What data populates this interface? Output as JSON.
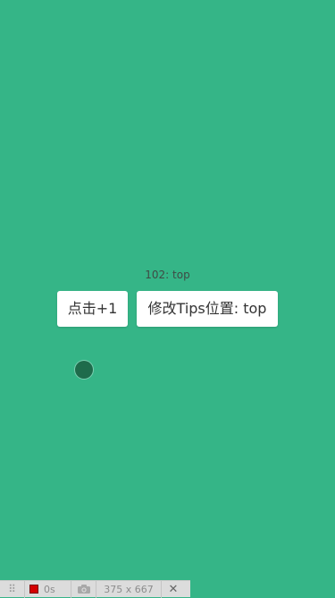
{
  "tip": {
    "text": "102: top"
  },
  "buttons": {
    "increment_label": "点击+1",
    "position_label": "修改Tips位置: top"
  },
  "toolbar": {
    "grip_glyph": "⠿",
    "timer": "0s",
    "dimensions": "375 x 667",
    "close_glyph": "✕"
  },
  "colors": {
    "background": "#35b587",
    "touch_dot": "#1e6b4b",
    "record": "#d40000"
  }
}
